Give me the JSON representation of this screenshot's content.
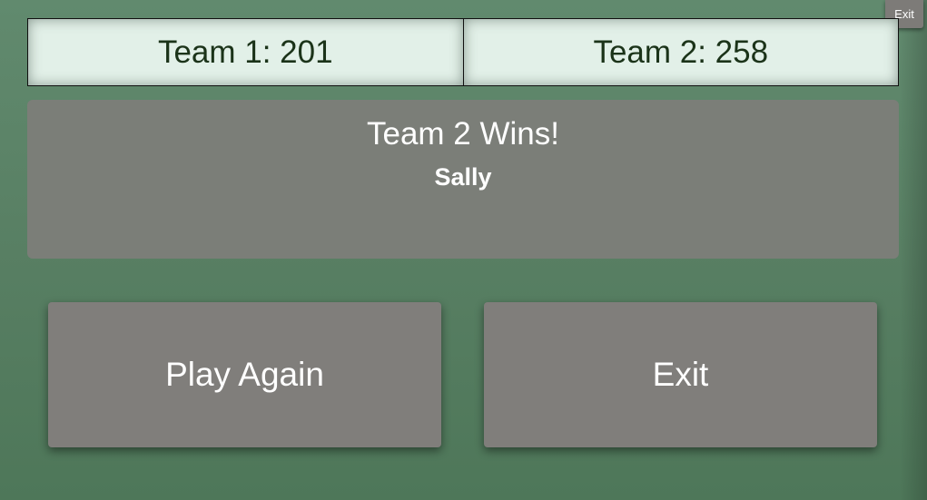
{
  "corner_exit_label": "Exit",
  "scoreboard": {
    "team1": "Team 1: 201",
    "team2": "Team 2: 258"
  },
  "result": {
    "title": "Team 2 Wins!",
    "player": "Sally"
  },
  "actions": {
    "play_again": "Play Again",
    "exit": "Exit"
  }
}
